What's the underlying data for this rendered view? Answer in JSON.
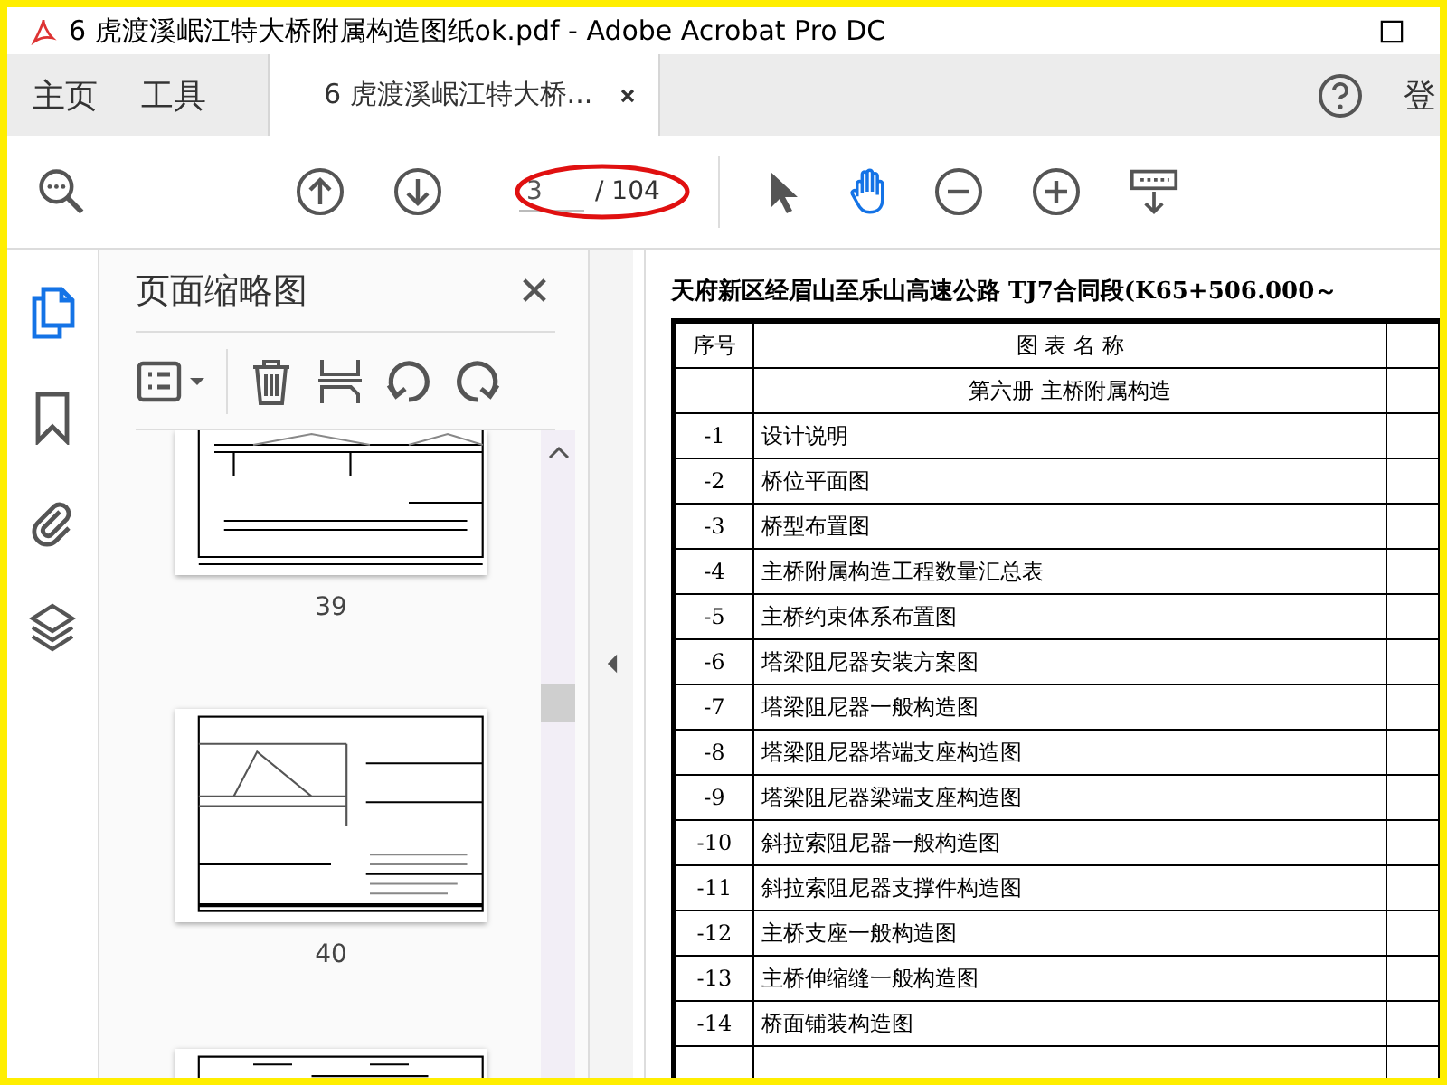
{
  "window": {
    "title": "6 虎渡溪岷江特大桥附属构造图纸ok.pdf - Adobe Acrobat Pro DC"
  },
  "tabs": [
    {
      "label": "主页",
      "selected": false
    },
    {
      "label": "工具",
      "selected": false
    },
    {
      "label": "6 虎渡溪岷江特大桥...",
      "selected": true
    }
  ],
  "account_label": "登",
  "toolbar": {
    "page_field": {
      "value": "3"
    },
    "page_total": "/ 104",
    "tools": [
      {
        "kind": "select",
        "selected": false
      },
      {
        "kind": "hand",
        "selected": true
      }
    ]
  },
  "left_rail": [
    {
      "kind": "pages",
      "selected": true
    },
    {
      "kind": "bookmarks",
      "selected": false
    },
    {
      "kind": "attachments",
      "selected": false
    },
    {
      "kind": "layers",
      "selected": false
    }
  ],
  "panel": {
    "title": "页面缩略图",
    "thumbnails": [
      {
        "kind": "top-cut",
        "label": "39"
      },
      {
        "kind": "full",
        "label": "40"
      },
      {
        "kind": "bottom-cut"
      }
    ]
  },
  "document": {
    "heading": "天府新区经眉山至乐山高速公路 TJ7合同段(K65+506.000～",
    "columns": [
      "序号",
      "图 表 名 称"
    ],
    "section": "第六册 主桥附属构造",
    "rows": [
      {
        "no": "-1",
        "name": "设计说明"
      },
      {
        "no": "-2",
        "name": "桥位平面图"
      },
      {
        "no": "-3",
        "name": "桥型布置图"
      },
      {
        "no": "-4",
        "name": "主桥附属构造工程数量汇总表"
      },
      {
        "no": "-5",
        "name": "主桥约束体系布置图"
      },
      {
        "no": "-6",
        "name": "塔梁阻尼器安装方案图"
      },
      {
        "no": "-7",
        "name": "塔梁阻尼器一般构造图"
      },
      {
        "no": "-8",
        "name": "塔梁阻尼器塔端支座构造图"
      },
      {
        "no": "-9",
        "name": "塔梁阻尼器梁端支座构造图"
      },
      {
        "no": "-10",
        "name": "斜拉索阻尼器一般构造图"
      },
      {
        "no": "-11",
        "name": "斜拉索阻尼器支撑件构造图"
      },
      {
        "no": "-12",
        "name": "主桥支座一般构造图"
      },
      {
        "no": "-13",
        "name": "主桥伸缩缝一般构造图"
      },
      {
        "no": "-14",
        "name": "桥面铺装构造图"
      }
    ]
  }
}
